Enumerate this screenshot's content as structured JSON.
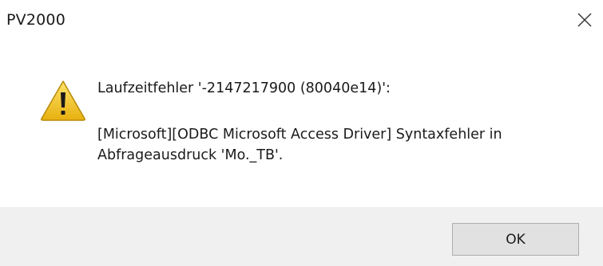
{
  "window": {
    "title": "PV2000"
  },
  "message": {
    "line1": "Laufzeitfehler '-2147217900 (80040e14)':",
    "line2": "[Microsoft][ODBC Microsoft Access Driver] Syntaxfehler in",
    "line3": "Abfrageausdruck 'Mo._TB'."
  },
  "buttons": {
    "ok_label": "OK"
  },
  "icons": {
    "warning": "warning-icon",
    "close": "close-icon"
  },
  "colors": {
    "footer_bg": "#f0f0f0",
    "warning_yellow": "#f2c21a",
    "button_border": "#adadad"
  }
}
